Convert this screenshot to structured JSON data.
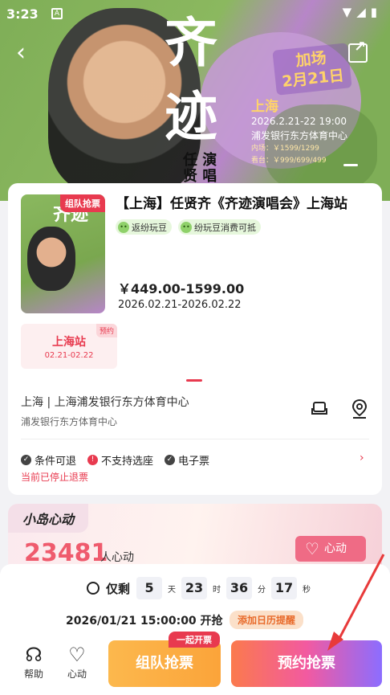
{
  "status_bar": {
    "time": "3:23",
    "app_icon": "A"
  },
  "banner": {
    "big_char_1": "齐",
    "big_char_2": "迹",
    "vertical_text": "任 演 贤 唱",
    "extra_show": "加场",
    "extra_date": "2月21日",
    "city": "上海",
    "datetime": "2026.2.21-22 19:00",
    "venue": "浦发银行东方体育中心",
    "price_inner": "内场：￥1599/1299",
    "price_stand": "看台：￥999/699/499"
  },
  "event": {
    "poster_tag": "组队抢票",
    "poster_text": "齐迹",
    "title": "【上海】任贤齐《齐迹演唱会》上海站",
    "badges": [
      "返纷玩豆",
      "纷玩豆消费可抵"
    ],
    "price": "￥449.00-1599.00",
    "date_range": "2026.02.21-2026.02.22",
    "station": {
      "name": "上海站",
      "dates": "02.21-02.22",
      "tag": "预约"
    },
    "venue": "上海 | 上海浦发银行东方体育中心",
    "venue_sub": "浦发银行东方体育中心",
    "rules": [
      {
        "label": "条件可退",
        "icon": "check-icon"
      },
      {
        "label": "不支持选座",
        "icon": "alert-icon"
      },
      {
        "label": "电子票",
        "icon": "check-icon"
      }
    ],
    "refund_note": "当前已停止退票"
  },
  "heart": {
    "title": "小岛心动",
    "count": "23481",
    "unit": "人心动",
    "button": "心动"
  },
  "bottom": {
    "countdown_label": "仅剩",
    "days": "5",
    "days_unit": "天",
    "hours": "23",
    "hours_unit": "时",
    "minutes": "36",
    "minutes_unit": "分",
    "seconds": "17",
    "seconds_unit": "秒",
    "start_time": "2026/01/21 15:00:00 开抢",
    "remind_button": "添加日历提醒",
    "nav_help": "帮助",
    "nav_heart": "心动",
    "team_button": "组队抢票",
    "team_tag": "一起开票",
    "book_button": "预约抢票"
  },
  "colors": {
    "accent": "#e83a4f",
    "heart": "#ef5b6d",
    "team": "#fba43a"
  }
}
